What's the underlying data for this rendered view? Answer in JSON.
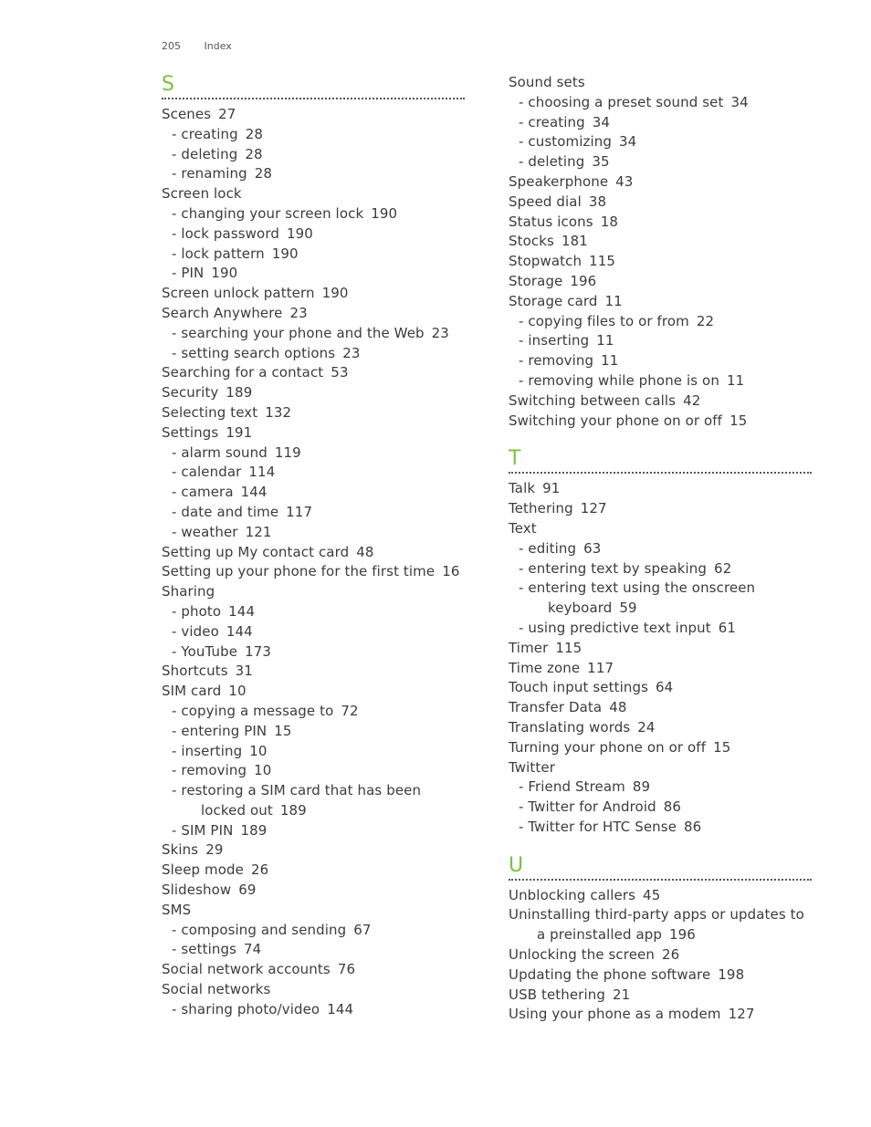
{
  "header": {
    "page_number": "205",
    "title": "Index"
  },
  "columns": [
    {
      "sections": [
        {
          "letter": "S",
          "entries": [
            {
              "level": 0,
              "text": "Scenes",
              "page": "27"
            },
            {
              "level": 1,
              "text": "- creating",
              "page": "28"
            },
            {
              "level": 1,
              "text": "- deleting",
              "page": "28"
            },
            {
              "level": 1,
              "text": "- renaming",
              "page": "28"
            },
            {
              "level": 0,
              "text": "Screen lock",
              "page": ""
            },
            {
              "level": 1,
              "text": "- changing your screen lock",
              "page": "190"
            },
            {
              "level": 1,
              "text": "- lock password",
              "page": "190"
            },
            {
              "level": 1,
              "text": "- lock pattern",
              "page": "190"
            },
            {
              "level": 1,
              "text": "- PIN",
              "page": "190"
            },
            {
              "level": 0,
              "text": "Screen unlock pattern",
              "page": "190"
            },
            {
              "level": 0,
              "text": "Search Anywhere",
              "page": "23"
            },
            {
              "level": 1,
              "text": "- searching your phone and the Web",
              "page": "23"
            },
            {
              "level": 1,
              "text": "- setting search options",
              "page": "23"
            },
            {
              "level": 0,
              "text": "Searching for a contact",
              "page": "53"
            },
            {
              "level": 0,
              "text": "Security",
              "page": "189"
            },
            {
              "level": 0,
              "text": "Selecting text",
              "page": "132"
            },
            {
              "level": 0,
              "text": "Settings",
              "page": "191"
            },
            {
              "level": 1,
              "text": "- alarm sound",
              "page": "119"
            },
            {
              "level": 1,
              "text": "- calendar",
              "page": "114"
            },
            {
              "level": 1,
              "text": "- camera",
              "page": "144"
            },
            {
              "level": 1,
              "text": "- date and time",
              "page": "117"
            },
            {
              "level": 1,
              "text": "- weather",
              "page": "121"
            },
            {
              "level": 0,
              "text": "Setting up My contact card",
              "page": "48"
            },
            {
              "level": 0,
              "text": "Setting up your phone for the first time",
              "page": "16"
            },
            {
              "level": 0,
              "text": "Sharing",
              "page": ""
            },
            {
              "level": 1,
              "text": "- photo",
              "page": "144"
            },
            {
              "level": 1,
              "text": "- video",
              "page": "144"
            },
            {
              "level": 1,
              "text": "- YouTube",
              "page": "173"
            },
            {
              "level": 0,
              "text": "Shortcuts",
              "page": "31"
            },
            {
              "level": 0,
              "text": "SIM card",
              "page": "10"
            },
            {
              "level": 1,
              "text": "- copying a message to",
              "page": "72"
            },
            {
              "level": 1,
              "text": "- entering PIN",
              "page": "15"
            },
            {
              "level": 1,
              "text": "- inserting",
              "page": "10"
            },
            {
              "level": 1,
              "text": "- removing",
              "page": "10"
            },
            {
              "level": 1,
              "text": "- restoring a SIM card that has been",
              "continuation": "locked out",
              "page": "189"
            },
            {
              "level": 1,
              "text": "- SIM PIN",
              "page": "189"
            },
            {
              "level": 0,
              "text": "Skins",
              "page": "29"
            },
            {
              "level": 0,
              "text": "Sleep mode",
              "page": "26"
            },
            {
              "level": 0,
              "text": "Slideshow",
              "page": "69"
            },
            {
              "level": 0,
              "text": "SMS",
              "page": ""
            },
            {
              "level": 1,
              "text": "- composing and sending",
              "page": "67"
            },
            {
              "level": 1,
              "text": "- settings",
              "page": "74"
            },
            {
              "level": 0,
              "text": "Social network accounts",
              "page": "76"
            },
            {
              "level": 0,
              "text": "Social networks",
              "page": ""
            },
            {
              "level": 1,
              "text": "- sharing photo/video",
              "page": "144"
            }
          ]
        }
      ]
    },
    {
      "sections": [
        {
          "letter": "",
          "entries": [
            {
              "level": 0,
              "text": "Sound sets",
              "page": ""
            },
            {
              "level": 1,
              "text": "- choosing a preset sound set",
              "page": "34"
            },
            {
              "level": 1,
              "text": "- creating",
              "page": "34"
            },
            {
              "level": 1,
              "text": "- customizing",
              "page": "34"
            },
            {
              "level": 1,
              "text": "- deleting",
              "page": "35"
            },
            {
              "level": 0,
              "text": "Speakerphone",
              "page": "43"
            },
            {
              "level": 0,
              "text": "Speed dial",
              "page": "38"
            },
            {
              "level": 0,
              "text": "Status icons",
              "page": "18"
            },
            {
              "level": 0,
              "text": "Stocks",
              "page": "181"
            },
            {
              "level": 0,
              "text": "Stopwatch",
              "page": "115"
            },
            {
              "level": 0,
              "text": "Storage",
              "page": "196"
            },
            {
              "level": 0,
              "text": "Storage card",
              "page": "11"
            },
            {
              "level": 1,
              "text": "- copying files to or from",
              "page": "22"
            },
            {
              "level": 1,
              "text": "- inserting",
              "page": "11"
            },
            {
              "level": 1,
              "text": "- removing",
              "page": "11"
            },
            {
              "level": 1,
              "text": "- removing while phone is on",
              "page": "11"
            },
            {
              "level": 0,
              "text": "Switching between calls",
              "page": "42"
            },
            {
              "level": 0,
              "text": "Switching your phone on or off",
              "page": "15"
            }
          ]
        },
        {
          "letter": "T",
          "entries": [
            {
              "level": 0,
              "text": "Talk",
              "page": "91"
            },
            {
              "level": 0,
              "text": "Tethering",
              "page": "127"
            },
            {
              "level": 0,
              "text": "Text",
              "page": ""
            },
            {
              "level": 1,
              "text": "- editing",
              "page": "63"
            },
            {
              "level": 1,
              "text": "- entering text by speaking",
              "page": "62"
            },
            {
              "level": 1,
              "text": "- entering text using the onscreen",
              "continuation": "keyboard",
              "page": "59"
            },
            {
              "level": 1,
              "text": "- using predictive text input",
              "page": "61"
            },
            {
              "level": 0,
              "text": "Timer",
              "page": "115"
            },
            {
              "level": 0,
              "text": "Time zone",
              "page": "117"
            },
            {
              "level": 0,
              "text": "Touch input settings",
              "page": "64"
            },
            {
              "level": 0,
              "text": "Transfer Data",
              "page": "48"
            },
            {
              "level": 0,
              "text": "Translating words",
              "page": "24"
            },
            {
              "level": 0,
              "text": "Turning your phone on or off",
              "page": "15"
            },
            {
              "level": 0,
              "text": "Twitter",
              "page": ""
            },
            {
              "level": 1,
              "text": "- Friend Stream",
              "page": "89"
            },
            {
              "level": 1,
              "text": "- Twitter for Android",
              "page": "86"
            },
            {
              "level": 1,
              "text": "- Twitter for HTC Sense",
              "page": "86"
            }
          ]
        },
        {
          "letter": "U",
          "entries": [
            {
              "level": 0,
              "text": "Unblocking callers",
              "page": "45"
            },
            {
              "level": 0,
              "text": "Uninstalling third-party apps or updates to",
              "continuation": "a preinstalled app",
              "page": "196"
            },
            {
              "level": 0,
              "text": "Unlocking the screen",
              "page": "26"
            },
            {
              "level": 0,
              "text": "Updating the phone software",
              "page": "198"
            },
            {
              "level": 0,
              "text": "USB tethering",
              "page": "21"
            },
            {
              "level": 0,
              "text": "Using your phone as a modem",
              "page": "127"
            }
          ]
        }
      ]
    }
  ],
  "colors": {
    "section_letter": "#7ac143",
    "text": "#3c3c3c"
  }
}
